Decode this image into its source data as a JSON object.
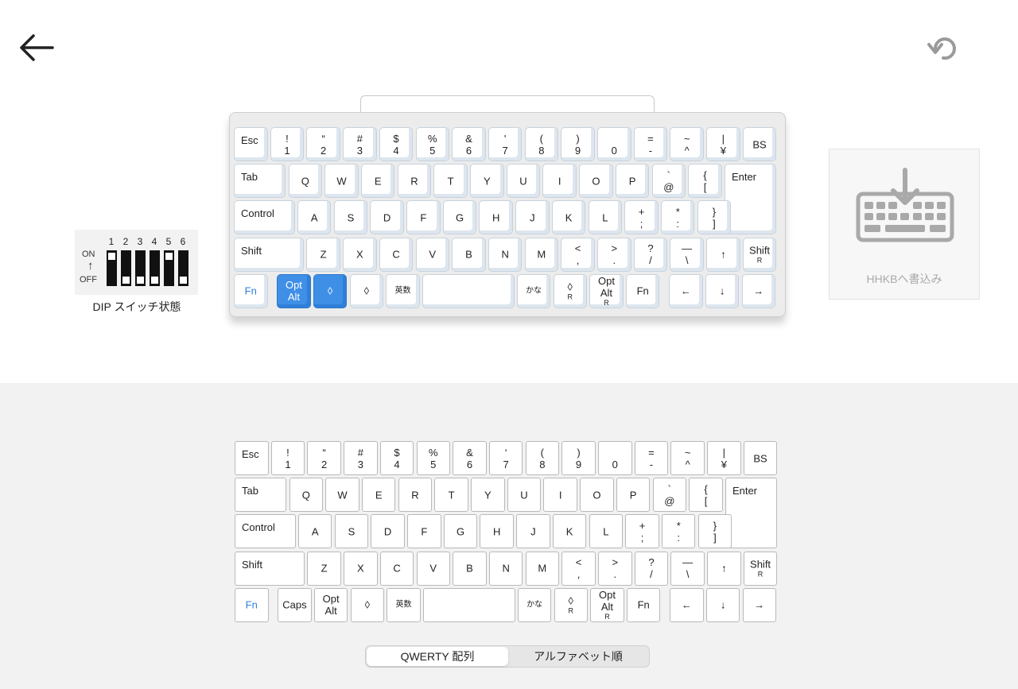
{
  "header": {
    "back_icon": "arrow-left-icon",
    "undo_icon": "undo-icon"
  },
  "dip": {
    "numbers": [
      "1",
      "2",
      "3",
      "4",
      "5",
      "6"
    ],
    "on_label": "ON",
    "off_label": "OFF",
    "arrow": "↑",
    "states": [
      "on",
      "off",
      "off",
      "off",
      "on",
      "off"
    ],
    "caption": "DIP スイッチ状態"
  },
  "write_button": {
    "label": "HHKBへ書込み",
    "icon": "keyboard-download-icon"
  },
  "keyboard_top": {
    "rows": [
      [
        {
          "t": "Esc",
          "w": 1,
          "s": "tl"
        },
        {
          "t": "!\n1",
          "w": 1
        },
        {
          "t": "“\n2",
          "w": 1
        },
        {
          "t": "#\n3",
          "w": 1
        },
        {
          "t": "$\n4",
          "w": 1
        },
        {
          "t": "%\n5",
          "w": 1
        },
        {
          "t": "&\n6",
          "w": 1
        },
        {
          "t": "'\n7",
          "w": 1
        },
        {
          "t": "(\n8",
          "w": 1
        },
        {
          "t": ")\n9",
          "w": 1
        },
        {
          "t": "\n0",
          "w": 1
        },
        {
          "t": "=\n-",
          "w": 1
        },
        {
          "t": "~\n^",
          "w": 1
        },
        {
          "t": "|\n¥",
          "w": 1
        },
        {
          "t": "BS",
          "w": 1
        }
      ],
      [
        {
          "t": "Tab",
          "w": 1.5,
          "s": "tl"
        },
        {
          "t": "Q",
          "w": 1
        },
        {
          "t": "W",
          "w": 1
        },
        {
          "t": "E",
          "w": 1
        },
        {
          "t": "R",
          "w": 1
        },
        {
          "t": "T",
          "w": 1
        },
        {
          "t": "Y",
          "w": 1
        },
        {
          "t": "U",
          "w": 1
        },
        {
          "t": "I",
          "w": 1
        },
        {
          "t": "O",
          "w": 1
        },
        {
          "t": "P",
          "w": 1
        },
        {
          "t": "`\n@",
          "w": 1
        },
        {
          "t": "{\n[",
          "w": 1
        },
        {
          "t": "Enter",
          "w": 1.5,
          "s": "tl",
          "tall": true
        }
      ],
      [
        {
          "t": "Control",
          "w": 1.75,
          "s": "tl"
        },
        {
          "t": "A",
          "w": 1
        },
        {
          "t": "S",
          "w": 1
        },
        {
          "t": "D",
          "w": 1
        },
        {
          "t": "F",
          "w": 1
        },
        {
          "t": "G",
          "w": 1
        },
        {
          "t": "H",
          "w": 1
        },
        {
          "t": "J",
          "w": 1
        },
        {
          "t": "K",
          "w": 1
        },
        {
          "t": "L",
          "w": 1
        },
        {
          "t": "+\n;",
          "w": 1
        },
        {
          "t": "*\n:",
          "w": 1
        },
        {
          "t": "}\n]",
          "w": 1
        }
      ],
      [
        {
          "t": "Shift",
          "w": 2,
          "s": "tl"
        },
        {
          "t": "Z",
          "w": 1
        },
        {
          "t": "X",
          "w": 1
        },
        {
          "t": "C",
          "w": 1
        },
        {
          "t": "V",
          "w": 1
        },
        {
          "t": "B",
          "w": 1
        },
        {
          "t": "N",
          "w": 1
        },
        {
          "t": "M",
          "w": 1
        },
        {
          "t": "<\n,",
          "w": 1
        },
        {
          "t": ">\n.",
          "w": 1
        },
        {
          "t": "?\n/",
          "w": 1
        },
        {
          "t": "—\n\\",
          "w": 1
        },
        {
          "t": "↑",
          "w": 1
        },
        {
          "t": "Shift\nR",
          "w": 1,
          "sub": true
        }
      ],
      [
        {
          "t": "Fn",
          "w": 1,
          "blue": true
        },
        {
          "gap": 0.2
        },
        {
          "t": "Opt\nAlt",
          "w": 1,
          "sel": true
        },
        {
          "t": "◊",
          "w": 1,
          "sel": true
        },
        {
          "t": "◊",
          "w": 1
        },
        {
          "t": "英数",
          "w": 1,
          "smtext": true
        },
        {
          "t": "",
          "w": 2.6
        },
        {
          "t": "かな",
          "w": 1,
          "smtext": true
        },
        {
          "t": "◊\nR",
          "w": 1,
          "sub": true
        },
        {
          "t": "Opt\nAlt\nR",
          "w": 1,
          "sub": true
        },
        {
          "t": "Fn",
          "w": 1
        },
        {
          "gap": 0.2
        },
        {
          "t": "←",
          "w": 1
        },
        {
          "t": "↓",
          "w": 1
        },
        {
          "t": "→",
          "w": 1
        }
      ]
    ]
  },
  "keyboard_bottom": {
    "rows": [
      [
        {
          "t": "Esc",
          "w": 1,
          "s": "tl"
        },
        {
          "t": "!\n1",
          "w": 1
        },
        {
          "t": "“\n2",
          "w": 1
        },
        {
          "t": "#\n3",
          "w": 1
        },
        {
          "t": "$\n4",
          "w": 1
        },
        {
          "t": "%\n5",
          "w": 1
        },
        {
          "t": "&\n6",
          "w": 1
        },
        {
          "t": "‘\n7",
          "w": 1
        },
        {
          "t": "(\n8",
          "w": 1
        },
        {
          "t": ")\n9",
          "w": 1
        },
        {
          "t": "\n0",
          "w": 1
        },
        {
          "t": "=\n-",
          "w": 1
        },
        {
          "t": "~\n^",
          "w": 1
        },
        {
          "t": "|\n¥",
          "w": 1
        },
        {
          "t": "BS",
          "w": 1
        }
      ],
      [
        {
          "t": "Tab",
          "w": 1.5,
          "s": "tl"
        },
        {
          "t": "Q",
          "w": 1
        },
        {
          "t": "W",
          "w": 1
        },
        {
          "t": "E",
          "w": 1
        },
        {
          "t": "R",
          "w": 1
        },
        {
          "t": "T",
          "w": 1
        },
        {
          "t": "Y",
          "w": 1
        },
        {
          "t": "U",
          "w": 1
        },
        {
          "t": "I",
          "w": 1
        },
        {
          "t": "O",
          "w": 1
        },
        {
          "t": "P",
          "w": 1
        },
        {
          "t": "`\n@",
          "w": 1
        },
        {
          "t": "{\n[",
          "w": 1
        },
        {
          "t": "Enter",
          "w": 1.5,
          "s": "tl",
          "tall": true
        }
      ],
      [
        {
          "t": "Control",
          "w": 1.75,
          "s": "tl"
        },
        {
          "t": "A",
          "w": 1
        },
        {
          "t": "S",
          "w": 1
        },
        {
          "t": "D",
          "w": 1
        },
        {
          "t": "F",
          "w": 1
        },
        {
          "t": "G",
          "w": 1
        },
        {
          "t": "H",
          "w": 1
        },
        {
          "t": "J",
          "w": 1
        },
        {
          "t": "K",
          "w": 1
        },
        {
          "t": "L",
          "w": 1
        },
        {
          "t": "+\n;",
          "w": 1
        },
        {
          "t": "*\n:",
          "w": 1
        },
        {
          "t": "}\n]",
          "w": 1
        }
      ],
      [
        {
          "t": "Shift",
          "w": 2,
          "s": "tl"
        },
        {
          "t": "Z",
          "w": 1
        },
        {
          "t": "X",
          "w": 1
        },
        {
          "t": "C",
          "w": 1
        },
        {
          "t": "V",
          "w": 1
        },
        {
          "t": "B",
          "w": 1
        },
        {
          "t": "N",
          "w": 1
        },
        {
          "t": "M",
          "w": 1
        },
        {
          "t": "<\n,",
          "w": 1
        },
        {
          "t": ">\n.",
          "w": 1
        },
        {
          "t": "?\n/",
          "w": 1
        },
        {
          "t": "—\n\\",
          "w": 1
        },
        {
          "t": "↑",
          "w": 1
        },
        {
          "t": "Shift\nR",
          "w": 1,
          "sub": true
        }
      ],
      [
        {
          "t": "Fn",
          "w": 1,
          "blue": true
        },
        {
          "gap": 0.2
        },
        {
          "t": "Caps",
          "w": 1
        },
        {
          "t": "Opt\nAlt",
          "w": 1
        },
        {
          "t": "◊",
          "w": 1
        },
        {
          "t": "英数",
          "w": 1,
          "smtext": true
        },
        {
          "t": "",
          "w": 2.6
        },
        {
          "t": "かな",
          "w": 1,
          "smtext": true
        },
        {
          "t": "◊\nR",
          "w": 1,
          "sub": true
        },
        {
          "t": "Opt\nAlt\nR",
          "w": 1,
          "sub": true
        },
        {
          "t": "Fn",
          "w": 1
        },
        {
          "gap": 0.2
        },
        {
          "t": "←",
          "w": 1
        },
        {
          "t": "↓",
          "w": 1
        },
        {
          "t": "→",
          "w": 1
        }
      ]
    ]
  },
  "segmented": {
    "options": [
      "QWERTY 配列",
      "アルファベット順"
    ],
    "active_index": 0
  },
  "colors": {
    "accent": "#3f8fe6",
    "fn_text": "#2f7fd8",
    "bottom_bg": "#f2f2f2"
  }
}
